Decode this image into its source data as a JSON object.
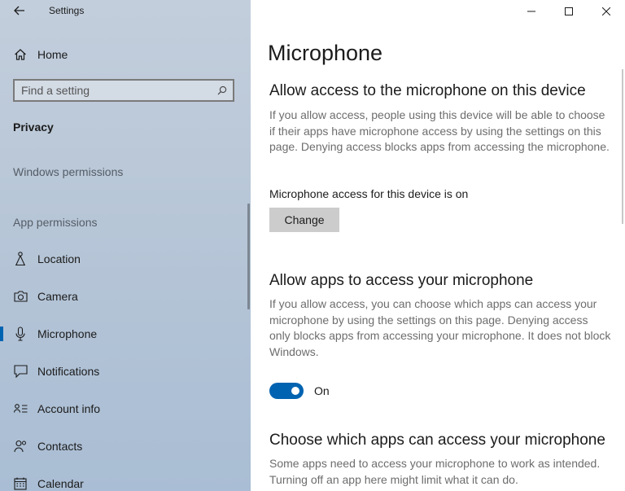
{
  "window": {
    "app_title": "Settings",
    "controls": {
      "minimize": "minimize-icon",
      "maximize": "maximize-icon",
      "close": "close-icon"
    }
  },
  "sidebar": {
    "home_label": "Home",
    "search": {
      "placeholder": "Find a setting",
      "value": ""
    },
    "section": "Privacy",
    "windows_permissions_label": "Windows permissions",
    "app_permissions_label": "App permissions",
    "items": [
      {
        "label": "Location",
        "icon": "location-icon",
        "active": false
      },
      {
        "label": "Camera",
        "icon": "camera-icon",
        "active": false
      },
      {
        "label": "Microphone",
        "icon": "microphone-icon",
        "active": true
      },
      {
        "label": "Notifications",
        "icon": "notifications-icon",
        "active": false
      },
      {
        "label": "Account info",
        "icon": "account-info-icon",
        "active": false
      },
      {
        "label": "Contacts",
        "icon": "contacts-icon",
        "active": false
      },
      {
        "label": "Calendar",
        "icon": "calendar-icon",
        "active": false
      }
    ],
    "accent_color": "#0063b1"
  },
  "main": {
    "title": "Microphone",
    "device_access": {
      "heading": "Allow access to the microphone on this device",
      "description": "If you allow access, people using this device will be able to choose if their apps have microphone access by using the settings on this page. Denying access blocks apps from accessing the microphone.",
      "status": "Microphone access for this device is on",
      "button_label": "Change"
    },
    "app_access": {
      "heading": "Allow apps to access your microphone",
      "description": "If you allow access, you can choose which apps can access your microphone by using the settings on this page. Denying access only blocks apps from accessing your microphone. It does not block Windows.",
      "toggle_on": true,
      "toggle_label": "On"
    },
    "choose_apps": {
      "heading": "Choose which apps can access your microphone",
      "description": "Some apps need to access your microphone to work as intended. Turning off an app here might limit what it can do."
    }
  }
}
